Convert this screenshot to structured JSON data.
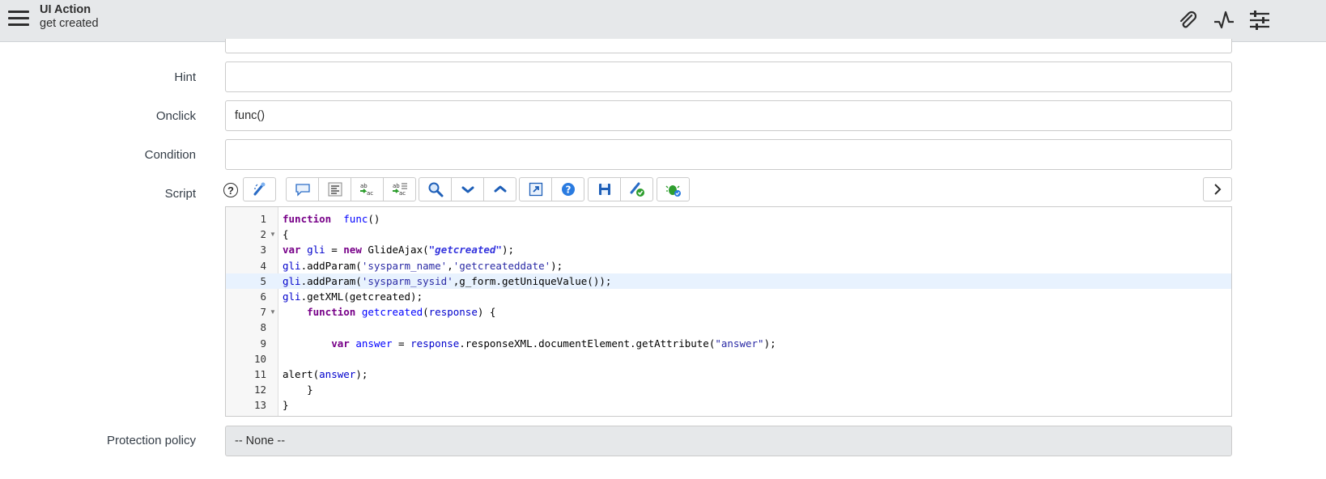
{
  "header": {
    "record_type": "UI Action",
    "record_name": "get created",
    "icons": [
      "paperclip-icon",
      "activity-icon",
      "settings-sliders-icon"
    ]
  },
  "form": {
    "hint": {
      "label": "Hint",
      "value": ""
    },
    "onclick": {
      "label": "Onclick",
      "value": "func()"
    },
    "condition": {
      "label": "Condition",
      "value": ""
    },
    "script": {
      "label": "Script",
      "help_symbol": "?"
    },
    "protection_policy": {
      "label": "Protection policy",
      "value": "-- None --"
    }
  },
  "toolbar": {
    "groups": [
      [
        "format-code-icon"
      ],
      [
        "comment-icon",
        "format-text-icon",
        "replace-icon",
        "replace-all-icon"
      ],
      [
        "search-icon",
        "next-icon",
        "previous-icon"
      ],
      [
        "fullscreen-icon",
        "help-icon"
      ],
      [
        "save-icon",
        "script-check-icon"
      ],
      [
        "debug-icon"
      ]
    ]
  },
  "editor": {
    "lines": [
      {
        "num": "1",
        "fold": "",
        "tokens": [
          [
            "kw",
            "function"
          ],
          [
            "",
            "  "
          ],
          [
            "def",
            "func"
          ],
          [
            "",
            "()"
          ]
        ]
      },
      {
        "num": "2",
        "fold": "▼",
        "tokens": [
          [
            "",
            "{"
          ]
        ]
      },
      {
        "num": "3",
        "fold": "",
        "tokens": [
          [
            "kw",
            "var"
          ],
          [
            "",
            " "
          ],
          [
            "vr",
            "gli"
          ],
          [
            "",
            " = "
          ],
          [
            "kw",
            "new"
          ],
          [
            "",
            " GlideAjax("
          ],
          [
            "strb",
            "\"getcreated\""
          ],
          [
            "",
            ");"
          ]
        ]
      },
      {
        "num": "4",
        "fold": "",
        "tokens": [
          [
            "vr",
            "gli"
          ],
          [
            "",
            ".addParam("
          ],
          [
            "str",
            "'sysparm_name'"
          ],
          [
            "",
            ","
          ],
          [
            "str",
            "'getcreateddate'"
          ],
          [
            "",
            ");"
          ]
        ]
      },
      {
        "num": "5",
        "fold": "",
        "highlight": true,
        "tokens": [
          [
            "vr",
            "gli"
          ],
          [
            "",
            ".addParam("
          ],
          [
            "str",
            "'sysparm_sysid'"
          ],
          [
            "",
            ",g_form.getUniqueValue());"
          ]
        ]
      },
      {
        "num": "6",
        "fold": "",
        "tokens": [
          [
            "vr",
            "gli"
          ],
          [
            "",
            ".getXML(getcreated);"
          ]
        ]
      },
      {
        "num": "7",
        "fold": "▼",
        "tokens": [
          [
            "",
            "    "
          ],
          [
            "kw",
            "function"
          ],
          [
            "",
            " "
          ],
          [
            "def",
            "getcreated"
          ],
          [
            "",
            "("
          ],
          [
            "vr",
            "response"
          ],
          [
            "",
            ") {"
          ]
        ]
      },
      {
        "num": "8",
        "fold": "",
        "tokens": []
      },
      {
        "num": "9",
        "fold": "",
        "tokens": [
          [
            "",
            "        "
          ],
          [
            "kw",
            "var"
          ],
          [
            "",
            " "
          ],
          [
            "def",
            "answer"
          ],
          [
            "",
            " = "
          ],
          [
            "vr",
            "response"
          ],
          [
            "",
            ".responseXML.documentElement.getAttribute("
          ],
          [
            "str",
            "\"answer\""
          ],
          [
            "",
            ");"
          ]
        ]
      },
      {
        "num": "10",
        "fold": "",
        "tokens": []
      },
      {
        "num": "11",
        "fold": "",
        "tokens": [
          [
            "",
            "alert("
          ],
          [
            "vr",
            "answer"
          ],
          [
            "",
            ");"
          ]
        ]
      },
      {
        "num": "12",
        "fold": "",
        "tokens": [
          [
            "",
            "    }"
          ]
        ]
      },
      {
        "num": "13",
        "fold": "",
        "tokens": [
          [
            "",
            "}"
          ]
        ]
      }
    ]
  }
}
